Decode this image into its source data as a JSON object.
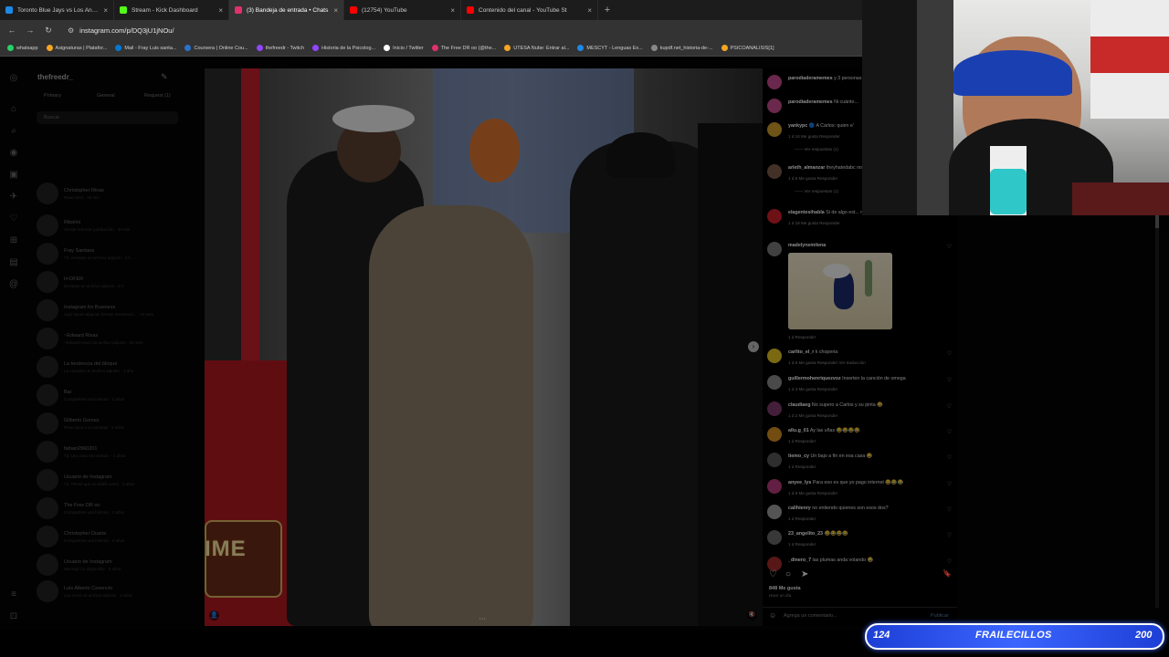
{
  "browser": {
    "tabs": [
      {
        "title": "Toronto Blue Jays vs Los Angeles D",
        "color": "#1e88e5",
        "active": false,
        "close": "×"
      },
      {
        "title": "Stream - Kick Dashboard",
        "color": "#53fc18",
        "active": false,
        "close": "×"
      },
      {
        "title": "(3) Bandeja de entrada • Chats",
        "color": "#e1306c",
        "active": true,
        "close": "×"
      },
      {
        "title": "(12754) YouTube",
        "color": "#ff0000",
        "active": false,
        "close": "×"
      },
      {
        "title": "Contenido del canal - YouTube St",
        "color": "#ff0000",
        "active": false,
        "close": "×"
      }
    ],
    "new_tab": "+",
    "nav": {
      "back": "←",
      "forward": "→",
      "reload": "↻"
    },
    "url": "instagram.com/p/DQ3jU1jNOu/",
    "bookmarks": [
      {
        "label": "whatsapp",
        "color": "#25d366"
      },
      {
        "label": "Asignaturas | Platafor...",
        "color": "#f5a623"
      },
      {
        "label": "Mail - Fray Luis santa...",
        "color": "#0078d4"
      },
      {
        "label": "Coursera | Online Cou...",
        "color": "#2a73cc"
      },
      {
        "label": "thefreedr - Twitch",
        "color": "#9146ff"
      },
      {
        "label": "Historia de la Psicolog...",
        "color": "#9146ff"
      },
      {
        "label": "Inicio / Twitter",
        "color": "#ffffff"
      },
      {
        "label": "The Free DR oo (@the...",
        "color": "#e1306c"
      },
      {
        "label": "UTESA Nube: Entrar al...",
        "color": "#f5a623"
      },
      {
        "label": "MESCYT - Lenguas Ex...",
        "color": "#1e88e5"
      },
      {
        "label": "kupdf.net_historia-de-...",
        "color": "#888888"
      },
      {
        "label": "PSICOANALISIS[1]",
        "color": "#f5a623"
      }
    ]
  },
  "dm": {
    "username": "thefreedr_",
    "tabs": [
      "Primary",
      "General",
      "Request (1)"
    ],
    "search_placeholder": "Buscar",
    "conversations": [
      {
        "name": "Christopher Rivas",
        "preview": "Reaccionó · 18 min"
      },
      {
        "name": "Ribelini",
        "preview": "Hiciste reenviar publicación · 30 min"
      },
      {
        "name": "Fray Santana",
        "preview": "Tú: enviaste un archivo adjunto · 4 h"
      },
      {
        "name": "H-OFER",
        "preview": "Enviaste un archivo adjunto · 5 h"
      },
      {
        "name": "Instagram for Business",
        "preview": "Aquí tienes algunas formas recomend... · 19 sem"
      },
      {
        "name": "~Edward Rivas",
        "preview": "~Edward envió un archivo adjunto · 50 sem"
      },
      {
        "name": "La tendencia del bloque",
        "preview": "La enviaste un archivo adjunto · 1 año"
      },
      {
        "name": "Bai",
        "preview": "Compartiste una historia · 2 años"
      },
      {
        "name": "Gilberto Gomez",
        "preview": "Reaccionó a tu mensaje · 2 años"
      },
      {
        "name": "fabian2960201",
        "preview": "Tú: Uno auto encontrado · 2 años"
      },
      {
        "name": "Usuario de Instagram",
        "preview": "Tú: Pensé que no hablé antes · 2 años"
      },
      {
        "name": "The Free DR oo",
        "preview": "Compartiste una historia · 2 años"
      },
      {
        "name": "Christopher Duarte",
        "preview": "Compartiste una historia · 3 años"
      },
      {
        "name": "Usuario de Instagram",
        "preview": "Mensaje no disponible · 3 años"
      },
      {
        "name": "Luis Alberto Cesencio",
        "preview": "Los envió un archivo adjunto · 4 años"
      }
    ]
  },
  "post": {
    "overlay_text": "IME",
    "next_icon": "›",
    "user_icon": "👤",
    "mute_icon": "🔇",
    "dots": "• • •",
    "comments": [
      {
        "user": "parodiaderamemes",
        "text": "y 3 personas más",
        "meta": "",
        "replies": ""
      },
      {
        "user": "parodiaderamemes",
        "text": "Ni cuánto...",
        "meta": "",
        "replies": ""
      },
      {
        "user": "yankypc",
        "text": "🔵 A Carlos: quien e'",
        "meta": "1 d   16 Me gusta   Responder",
        "replies": "—— Ver respuestas (1)"
      },
      {
        "user": "arleth_almanzar",
        "text": "theyhatedabc no encontró 😂😂😂😂",
        "meta": "1 d   6 Me gusta   Responder",
        "replies": "—— Ver respuestas (1)"
      },
      {
        "user": "elagentesihabla",
        "text": "Si de algo est... mejor que la del maestro y crazy 😂",
        "meta": "1 d   18 Me gusta   Responder",
        "replies": ""
      },
      {
        "user": "madelynemilena",
        "text": "",
        "meta": "1 d   Responder",
        "replies": ""
      },
      {
        "user": "carlito_el_r",
        "text": "k choperia",
        "meta": "1 d   6 Me gusta   Responder   Ver traducción",
        "replies": ""
      },
      {
        "user": "guillermohenriquezvoz",
        "text": "Inserten la canción de omega",
        "meta": "1 d   3 Me gusta   Responder",
        "replies": ""
      },
      {
        "user": "claudiaeg",
        "text": "No supero a Carlos y su pinta 😂",
        "meta": "1 d   2 Me gusta   Responder",
        "replies": ""
      },
      {
        "user": "allu.g_01",
        "text": "Ay las uñas 😂😂😂😂",
        "meta": "1 d   Responder",
        "replies": ""
      },
      {
        "user": "tiemo_cy",
        "text": "Un bajo a fin en esa casa 😂",
        "meta": "1 d   Responder",
        "replies": ""
      },
      {
        "user": "anyee_lys",
        "text": "Para eso es que yo pago internet 😂😂😂",
        "meta": "1 d   8 Me gusta   Responder",
        "replies": ""
      },
      {
        "user": "callhienry",
        "text": "no entiendo quienes son esos dos?",
        "meta": "1 d   Responder",
        "replies": ""
      },
      {
        "user": "23_angelito_23",
        "text": "😂😂😂😂",
        "meta": "1 d   Responder",
        "replies": ""
      },
      {
        "user": "_dinero_7",
        "text": "las plumas anda volando 😂",
        "meta": "",
        "replies": ""
      }
    ],
    "actions": {
      "like": "♡",
      "comment": "○",
      "share": "➤",
      "save": "🔖"
    },
    "likes": "848 Me gusta",
    "time": "Hace un día",
    "comment_placeholder": "Agrega un comentario...",
    "publish": "Publicar",
    "emoji_icon": "☺"
  },
  "stream_bar": {
    "left": "124",
    "center": "FRAILECILLOS",
    "right": "200"
  }
}
